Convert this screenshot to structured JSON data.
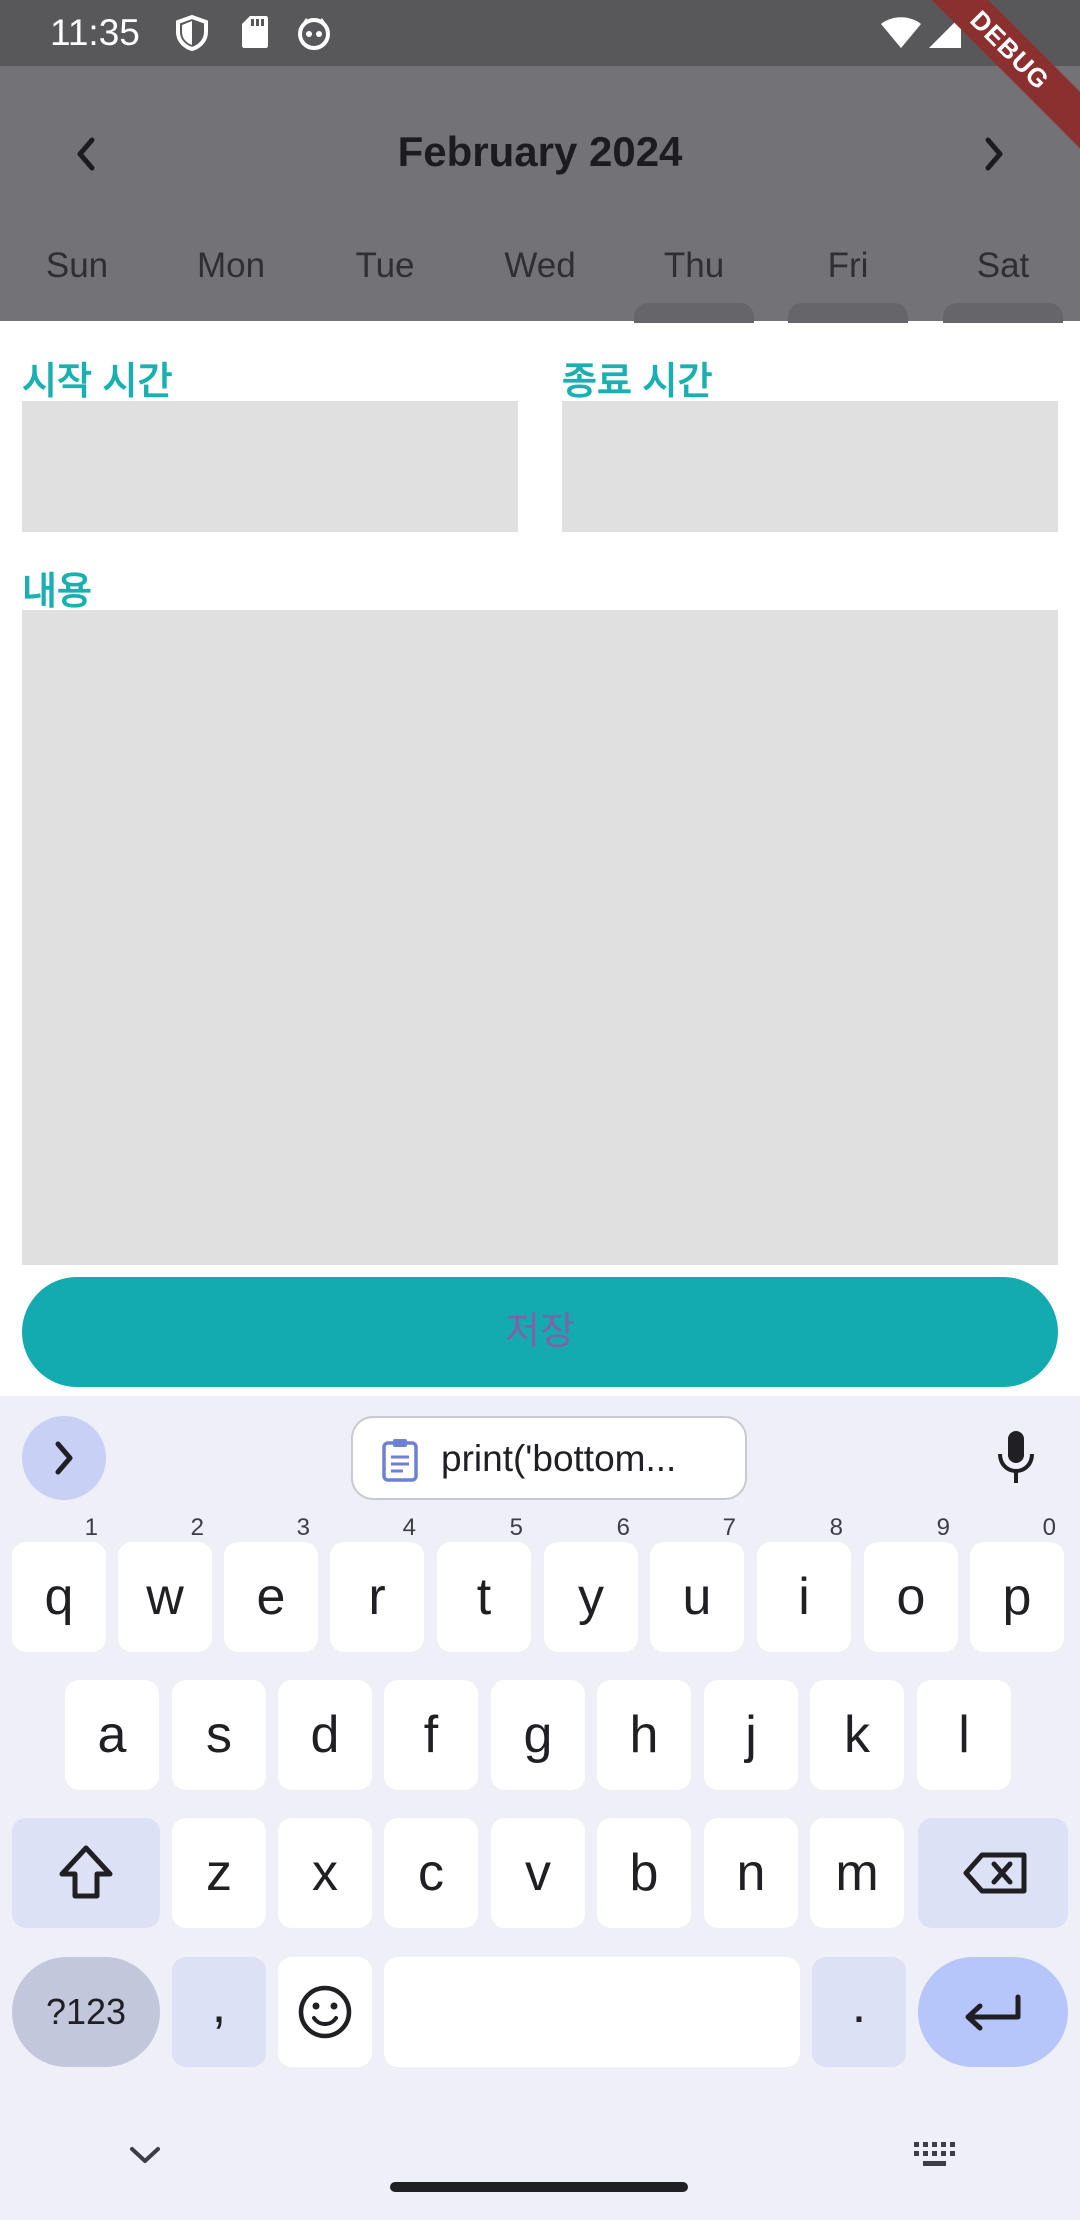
{
  "status_bar": {
    "time": "11:35",
    "debug_banner": "DEBUG"
  },
  "calendar": {
    "month": "February 2024",
    "weekdays": [
      "Sun",
      "Mon",
      "Tue",
      "Wed",
      "Thu",
      "Fri",
      "Sat"
    ]
  },
  "form": {
    "start_time_label": "시작 시간",
    "end_time_label": "종료 시간",
    "content_label": "내용",
    "save_label": "저장"
  },
  "keyboard": {
    "clipboard_suggestion": "print('bottom...",
    "row1": [
      {
        "key": "q",
        "sup": "1"
      },
      {
        "key": "w",
        "sup": "2"
      },
      {
        "key": "e",
        "sup": "3"
      },
      {
        "key": "r",
        "sup": "4"
      },
      {
        "key": "t",
        "sup": "5"
      },
      {
        "key": "y",
        "sup": "6"
      },
      {
        "key": "u",
        "sup": "7"
      },
      {
        "key": "i",
        "sup": "8"
      },
      {
        "key": "o",
        "sup": "9"
      },
      {
        "key": "p",
        "sup": "0"
      }
    ],
    "row2": [
      "a",
      "s",
      "d",
      "f",
      "g",
      "h",
      "j",
      "k",
      "l"
    ],
    "row3": [
      "z",
      "x",
      "c",
      "v",
      "b",
      "n",
      "m"
    ],
    "symbols_label": "?123",
    "comma_label": ",",
    "period_label": "."
  },
  "colors": {
    "accent": "#13abb0",
    "label": "#1aafb0",
    "field_bg": "#e0e0e0",
    "save_text": "#7f62a7",
    "keyboard_bg": "#efeff7",
    "enter_key": "#b6c6fb"
  }
}
